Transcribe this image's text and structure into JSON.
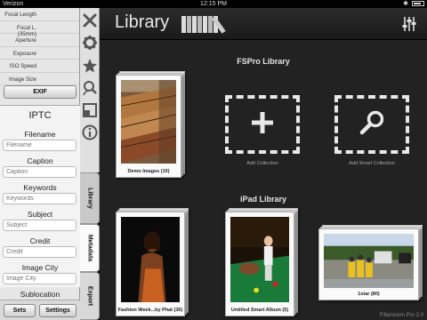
{
  "status_bar": {
    "carrier": "Verizon",
    "time": "12:15 PM"
  },
  "exif": {
    "fields": [
      "Focal Length",
      "Focal L.(35mm)",
      "Aperture",
      "Exposure",
      "ISO Speed",
      "Image Size"
    ],
    "button": "EXIF"
  },
  "iptc": {
    "title": "IPTC",
    "fields": [
      {
        "label": "Filename",
        "placeholder": "Filename"
      },
      {
        "label": "Caption",
        "placeholder": "Caption"
      },
      {
        "label": "Keywords",
        "placeholder": "Keywords"
      },
      {
        "label": "Subject",
        "placeholder": "Subject"
      },
      {
        "label": "Credit",
        "placeholder": "Credit"
      },
      {
        "label": "Image City",
        "placeholder": "Image City"
      },
      {
        "label": "Sublocation",
        "placeholder": ""
      }
    ]
  },
  "buttons": {
    "sets": "Sets",
    "settings": "Settings"
  },
  "side_icons": [
    "close-icon",
    "gear-icon",
    "star-icon",
    "people-search-icon",
    "crop-icon",
    "info-icon"
  ],
  "tabs": {
    "library": "Library",
    "metadata": "Metadata",
    "export": "Export"
  },
  "header": {
    "title": "Library"
  },
  "fspro": {
    "title": "FSPro Library",
    "albums": [
      {
        "caption": "Demo Images (10)"
      }
    ],
    "add_collection": "Add Collection",
    "add_smart_collection": "Add Smart Collection"
  },
  "ipad": {
    "title": "iPad Library",
    "albums": [
      {
        "caption": "Fashion Week...by Phat (36)"
      },
      {
        "caption": "Untitled Smart Album (5)"
      },
      {
        "caption": "1star (80)"
      }
    ]
  },
  "footer": {
    "watermark": "Filterstorm Pro 2.0"
  },
  "colors": {
    "panel": "#e6e6e6",
    "main_bg": "#222222",
    "text_light": "#e8e8e8"
  }
}
